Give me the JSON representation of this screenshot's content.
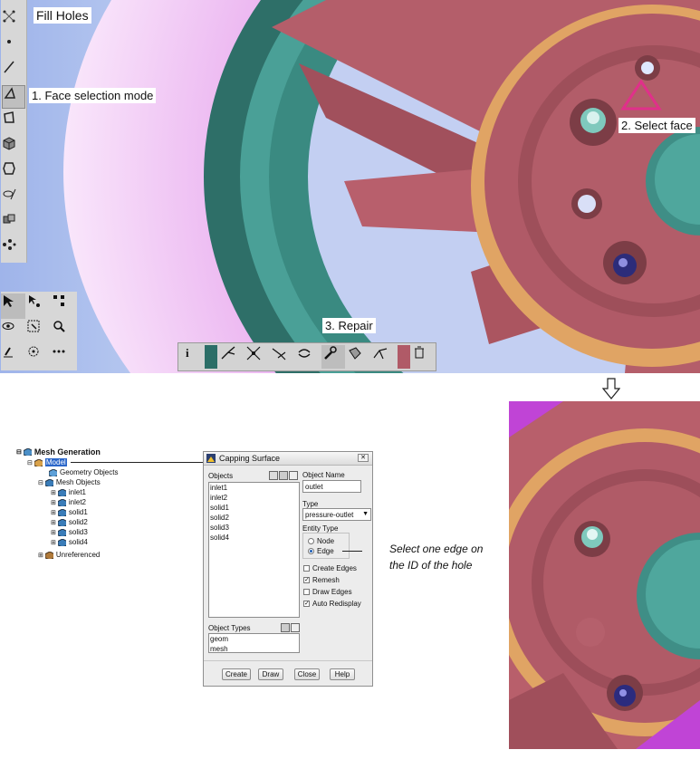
{
  "annotations": {
    "fill_holes": "Fill Holes",
    "face_selection_mode": "1. Face selection mode",
    "select_face": "2. Select face",
    "repair": "3. Repair",
    "select_edge_note": "Select one edge on the ID of the hole"
  },
  "tree": {
    "root": "Mesh Generation",
    "model": "Model",
    "geometry_objects": "Geometry Objects",
    "mesh_objects": "Mesh Objects",
    "items": [
      "inlet1",
      "inlet2",
      "solid1",
      "solid2",
      "solid3",
      "solid4"
    ],
    "unreferenced": "Unreferenced"
  },
  "dialog": {
    "title": "Capping Surface",
    "objects_label": "Objects",
    "objects": [
      "inlet1",
      "inlet2",
      "solid1",
      "solid2",
      "solid3",
      "solid4"
    ],
    "object_name_label": "Object Name",
    "object_name_value": "outlet",
    "type_label": "Type",
    "type_value": "pressure-outlet",
    "entity_type_label": "Entity Type",
    "entity_node": "Node",
    "entity_edge": "Edge",
    "create_edges": "Create Edges",
    "remesh": "Remesh",
    "draw_edges": "Draw Edges",
    "auto_redisplay": "Auto Redisplay",
    "object_types_label": "Object Types",
    "object_types": [
      "geom",
      "mesh"
    ],
    "buttons": {
      "create": "Create",
      "draw": "Draw",
      "close": "Close",
      "help": "Help"
    }
  },
  "colors": {
    "rim_pink": "#b9606c",
    "teal": "#4a9e95",
    "orange": "#e3a865",
    "magenta": "#bb4ed0",
    "selection": "#e0308a"
  }
}
